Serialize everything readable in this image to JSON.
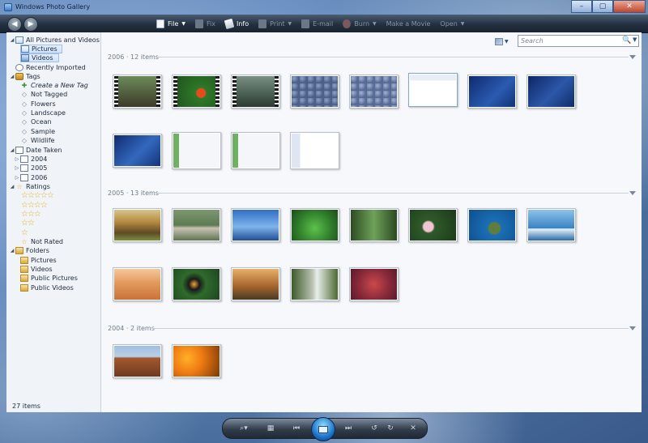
{
  "window": {
    "title": "Windows Photo Gallery",
    "controls": {
      "minimize": "–",
      "maximize": "▢",
      "close": "✕"
    }
  },
  "toolbar": {
    "back": "◀",
    "forward": "▶",
    "items": [
      {
        "label": "File",
        "caret": "▼",
        "enabled": true,
        "icon": "file-icon"
      },
      {
        "label": "Fix",
        "enabled": false,
        "icon": "fix-icon"
      },
      {
        "label": "Info",
        "enabled": true,
        "icon": "info-icon"
      },
      {
        "label": "Print",
        "caret": "▼",
        "enabled": false,
        "icon": "print-icon"
      },
      {
        "label": "E-mail",
        "enabled": false,
        "icon": "email-icon"
      },
      {
        "label": "Burn",
        "caret": "▼",
        "enabled": false,
        "icon": "burn-icon"
      },
      {
        "label": "Make a Movie",
        "enabled": false,
        "icon": "movie-icon"
      },
      {
        "label": "Open",
        "caret": "▼",
        "enabled": false,
        "icon": "open-icon"
      }
    ]
  },
  "sidebar": {
    "all": "All Pictures and Videos",
    "pictures": "Pictures",
    "videos": "Videos",
    "recent": "Recently Imported",
    "tags": "Tags",
    "tag_items": [
      "Create a New Tag",
      "Not Tagged",
      "Flowers",
      "Landscape",
      "Ocean",
      "Sample",
      "Wildlife"
    ],
    "date_taken": "Date Taken",
    "years": [
      "2004",
      "2005",
      "2006"
    ],
    "ratings": "Ratings",
    "star_rows": [
      "☆☆☆☆☆",
      "☆☆☆☆",
      "☆☆☆",
      "☆☆",
      "☆"
    ],
    "not_rated": "Not Rated",
    "folders": "Folders",
    "folder_items": [
      "Pictures",
      "Videos",
      "Public Pictures",
      "Public Videos"
    ]
  },
  "search": {
    "placeholder": "Search",
    "icon": "🔍",
    "caret": "▼"
  },
  "groups": [
    {
      "label": "2006 · 12 items",
      "count": 12
    },
    {
      "label": "2005 · 13 items",
      "count": 13
    },
    {
      "label": "2004 · 2 items",
      "count": 2
    }
  ],
  "status": "27 items",
  "colors": {
    "toolbar": "#23303f",
    "selection": "#cfe2fa",
    "background": "#f6f8fb"
  }
}
